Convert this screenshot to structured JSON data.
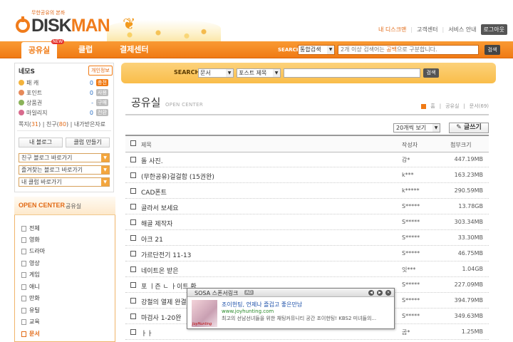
{
  "header": {
    "tagline": "무한공유의 본좌",
    "logo_disk": "DISK",
    "logo_man": "MAN",
    "links": [
      "내 디스크맨",
      "고객센터",
      "서비스 안내"
    ],
    "logout": "로그아웃"
  },
  "nav": {
    "tabs": [
      "공유실",
      "클럽",
      "결제센터"
    ],
    "new_badge": "NEW",
    "search_label": "SEARCH",
    "search_select": "통합검색",
    "search_hint_pre": "2개 이상 검색어는 ",
    "search_hint_key": "공백",
    "search_hint_post": "으로 구분합니다.",
    "search_button": "검색"
  },
  "user": {
    "name": "네모S",
    "profile_button": "개인정보",
    "stats": [
      {
        "icon": "cash-icon",
        "label": "패 캐",
        "value": "0",
        "button": "충전",
        "accent": true
      },
      {
        "icon": "point-icon",
        "label": "포인트",
        "value": "0",
        "button": "사용",
        "accent": false
      },
      {
        "icon": "coupon-icon",
        "label": "상품권",
        "value": "-",
        "button": "구매",
        "accent": false
      },
      {
        "icon": "mileage-icon",
        "label": "마일리지",
        "value": "0",
        "button": "전환",
        "accent": false
      }
    ],
    "friends_prefix": "쪽지(",
    "messages": "31",
    "friends_mid": ") | 친구(",
    "friends": "80",
    "friends_suffix": ") | 내가받은자료",
    "blog_button": "내 블로그",
    "club_button": "클럽 만들기",
    "selects": [
      "친구 블로그 바로가기",
      "즐겨찾는 블로그 바로가기",
      "내 클럽 바로가기"
    ]
  },
  "open_center": {
    "title": "OPEN CENTER",
    "subtitle": "공유실",
    "categories": [
      "전체",
      "영화",
      "드라마",
      "영상",
      "게임",
      "애니",
      "만화",
      "유틸",
      "교육",
      "문서"
    ],
    "active": "문서"
  },
  "main_search": {
    "label": "SEARCH",
    "select1": "문서",
    "select2": "포스트 제목"
  },
  "content": {
    "title": "공유실",
    "title_en": "OPEN CENTER",
    "breadcrumb": [
      "홈",
      "공유실",
      "문서(69)"
    ],
    "per_page": "20개씩 보기",
    "write_button": "글쓰기",
    "columns": [
      "제목",
      "작성자",
      "첨부크기"
    ],
    "rows": [
      {
        "title": "돌 사진.",
        "user": "감*",
        "size": "447.19MB"
      },
      {
        "title": "(무한공유)걸걸함 (15권완)",
        "user": "k***",
        "size": "163.23MB"
      },
      {
        "title": "CAD폰트",
        "user": "k*****",
        "size": "290.59MB"
      },
      {
        "title": "골라서 보세요",
        "user": "S*****",
        "size": "13.78GB"
      },
      {
        "title": "해골 제작자",
        "user": "S*****",
        "size": "303.34MB"
      },
      {
        "title": "아크 21",
        "user": "S*****",
        "size": "33.30MB"
      },
      {
        "title": "가르단전기 11-13",
        "user": "S*****",
        "size": "46.75MB"
      },
      {
        "title": "네이트온 받은",
        "user": "잇***",
        "size": "1.04GB"
      },
      {
        "title": "포 ㅣ즌 ㄴ ㅏ이트 환",
        "user": "S*****",
        "size": "227.09MB"
      },
      {
        "title": "강철의 열제 완결",
        "user": "S*****",
        "size": "394.79MB"
      },
      {
        "title": "마검사 1-20완",
        "user": "S*****",
        "size": "349.63MB"
      },
      {
        "title": "ㅏㅏ",
        "user": "곰*",
        "size": "1.25MB"
      }
    ]
  },
  "ad": {
    "title": "SOSA 스폰서링크",
    "badge": "AD",
    "image_caption": "JoyHunting",
    "line1": "조이헌팅, 언제나 즐겁고 좋은만남",
    "line2": "www.joyhunting.com",
    "line3": "최고의 선남선녀들을 위한 채팅커뮤니티 공간 조이헌팅! KBS2 미녀들의..."
  },
  "colors": {
    "accent": "#f07a14",
    "search_bar": "#f9bd4a",
    "link": "#1b4fa8"
  }
}
